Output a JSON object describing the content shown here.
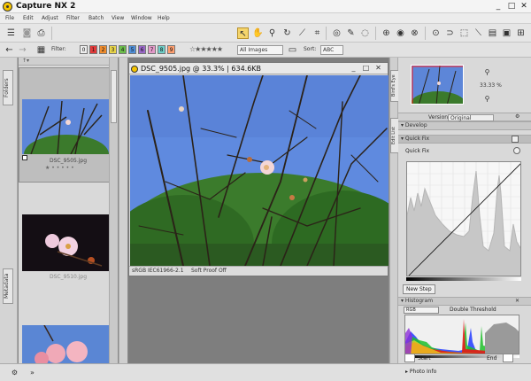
{
  "window": {
    "title": "Capture NX 2",
    "min": "_",
    "max": "□",
    "close": "✕"
  },
  "menu": [
    "File",
    "Edit",
    "Adjust",
    "Filter",
    "Batch",
    "View",
    "Window",
    "Help"
  ],
  "filterbar": {
    "filter_label": "Filter:",
    "labels": [
      "0",
      "1",
      "2",
      "3",
      "4",
      "5",
      "6",
      "7",
      "8",
      "9"
    ],
    "label_colors": [
      "#eeeeee",
      "#e33b3b",
      "#f08d2e",
      "#e8d44a",
      "#6cbd4b",
      "#4f8fd8",
      "#9b69c9",
      "#e39ac9",
      "#6fd0c9",
      "#ff9f6f"
    ],
    "stars": "☆★★★★★",
    "images_dropdown": "All Images",
    "sort_label": "Sort:",
    "sort_value": "ABC"
  },
  "left_tabs": {
    "folders": "Folders",
    "metadata": "Metadata"
  },
  "browser": {
    "header": "↑▾",
    "thumbnails": [
      {
        "caption": "DSC_9505.jpg",
        "rating": "★ • • • • •"
      },
      {
        "caption": "DSC_9510.jpg",
        "rating": ""
      },
      {
        "caption": "",
        "rating": ""
      }
    ]
  },
  "image_window": {
    "title": "DSC_9505.jpg @ 33.3% | 634.6KB",
    "status_left": "sRGB IEC61966-2.1",
    "status_mid": "Soft Proof Off"
  },
  "right_tabs": {
    "bird_eye": "Bird's Eye",
    "edit_list": "Edit List"
  },
  "birds_eye": {
    "zoom": "33.33 %"
  },
  "edit_list": {
    "versions_label": "Version:",
    "versions_value": "Original",
    "develop": "Develop",
    "quick_fix": "Quick Fix",
    "quick_fix_sub": "Quick Fix",
    "new_step": "New Step"
  },
  "histogram": {
    "title": "Histogram",
    "channel": "RGB",
    "threshold": "Double Threshold",
    "start_label": "Start",
    "end_label": "End"
  },
  "photo_info": {
    "title": "Photo Info"
  }
}
